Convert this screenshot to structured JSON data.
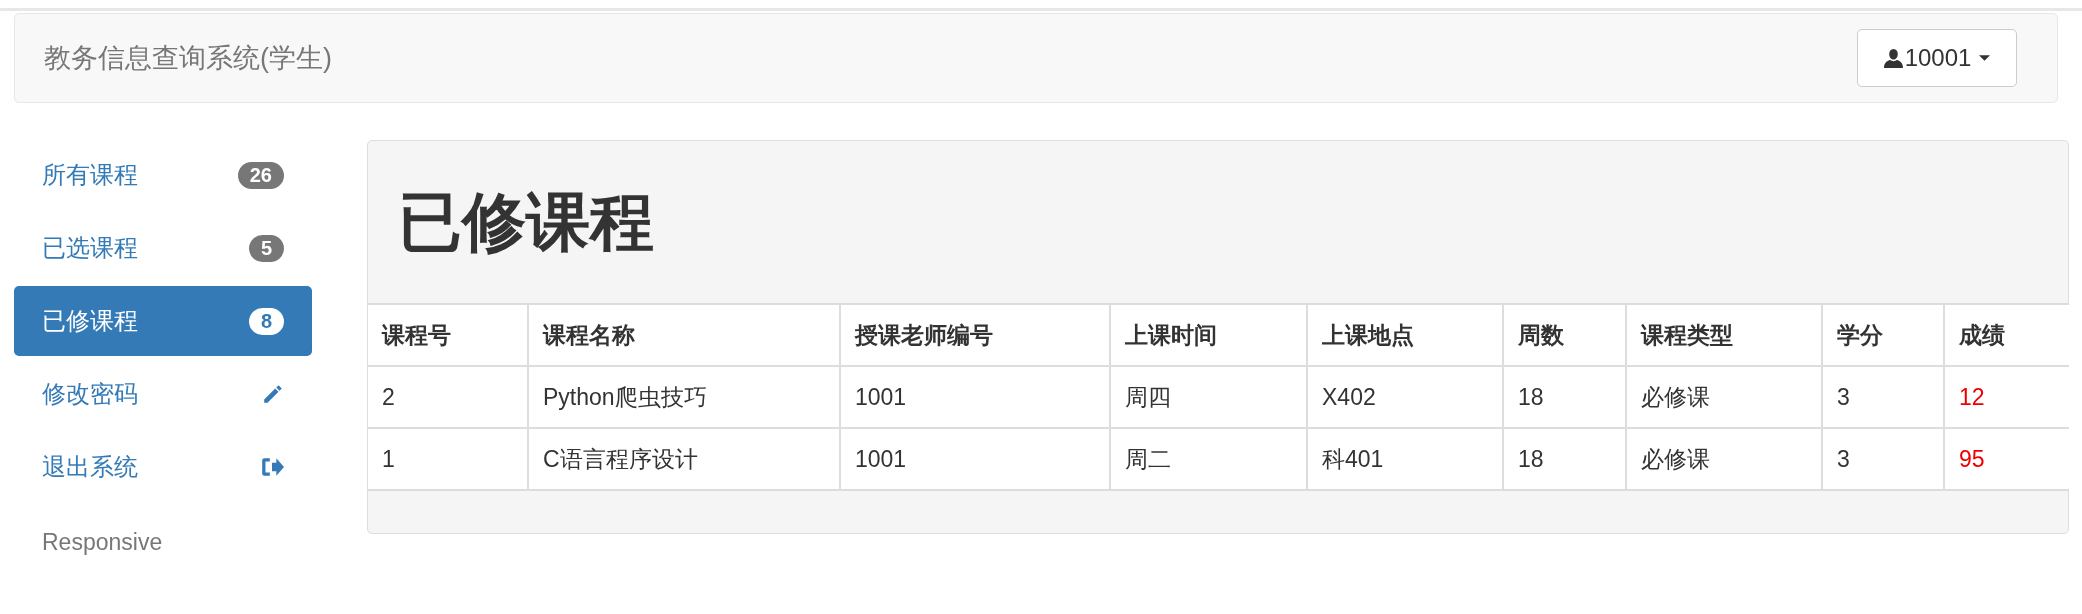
{
  "navbar": {
    "title": "教务信息查询系统(学生)",
    "user_button": {
      "label": "10001"
    }
  },
  "sidebar": {
    "items": [
      {
        "label": "所有课程",
        "kind": "badge",
        "badge": "26",
        "selected": false
      },
      {
        "label": "已选课程",
        "kind": "badge",
        "badge": "5",
        "selected": false
      },
      {
        "label": "已修课程",
        "kind": "badge",
        "badge": "8",
        "selected": true
      },
      {
        "label": "修改密码",
        "kind": "pencil",
        "selected": false
      },
      {
        "label": "退出系统",
        "kind": "logout",
        "selected": false
      }
    ],
    "footer": "Responsive"
  },
  "panel": {
    "heading": "已修课程",
    "table": {
      "columns": [
        "课程号",
        "课程名称",
        "授课老师编号",
        "上课时间",
        "上课地点",
        "周数",
        "课程类型",
        "学分",
        "成绩"
      ],
      "rows": [
        [
          "2",
          "Python爬虫技巧",
          "1001",
          "周四",
          "X402",
          "18",
          "必修课",
          "3",
          "12"
        ],
        [
          "1",
          "C语言程序设计",
          "1001",
          "周二",
          "科401",
          "18",
          "必修课",
          "3",
          "95"
        ]
      ]
    }
  }
}
